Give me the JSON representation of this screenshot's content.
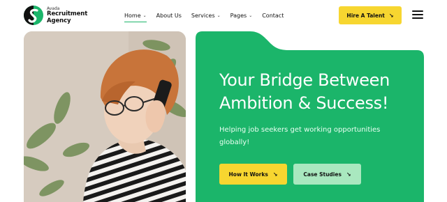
{
  "brand": {
    "name_small": "Avada",
    "name_line1": "Recruitment",
    "name_line2": "Agency",
    "colors": {
      "primary_green": "#1bb56a",
      "accent_yellow": "#f7d630",
      "light_green": "#a9e8bf"
    }
  },
  "nav": {
    "items": [
      {
        "label": "Home",
        "has_dropdown": true,
        "active": true
      },
      {
        "label": "About Us",
        "has_dropdown": false,
        "active": false
      },
      {
        "label": "Services",
        "has_dropdown": true,
        "active": false
      },
      {
        "label": "Pages",
        "has_dropdown": true,
        "active": false
      },
      {
        "label": "Contact",
        "has_dropdown": false,
        "active": false
      }
    ],
    "dropdown_icon": "chevron-down-icon"
  },
  "header": {
    "cta_label": "Hire A Talent",
    "cta_icon": "arrow-down-right-icon",
    "menu_icon": "hamburger-icon"
  },
  "hero": {
    "title": "Your Bridge Between Ambition & Success!",
    "subtitle": "Helping job seekers get working opportunities globally!",
    "primary_button": "How It Works",
    "secondary_button": "Case Studies",
    "button_icon": "arrow-down-right-icon"
  }
}
